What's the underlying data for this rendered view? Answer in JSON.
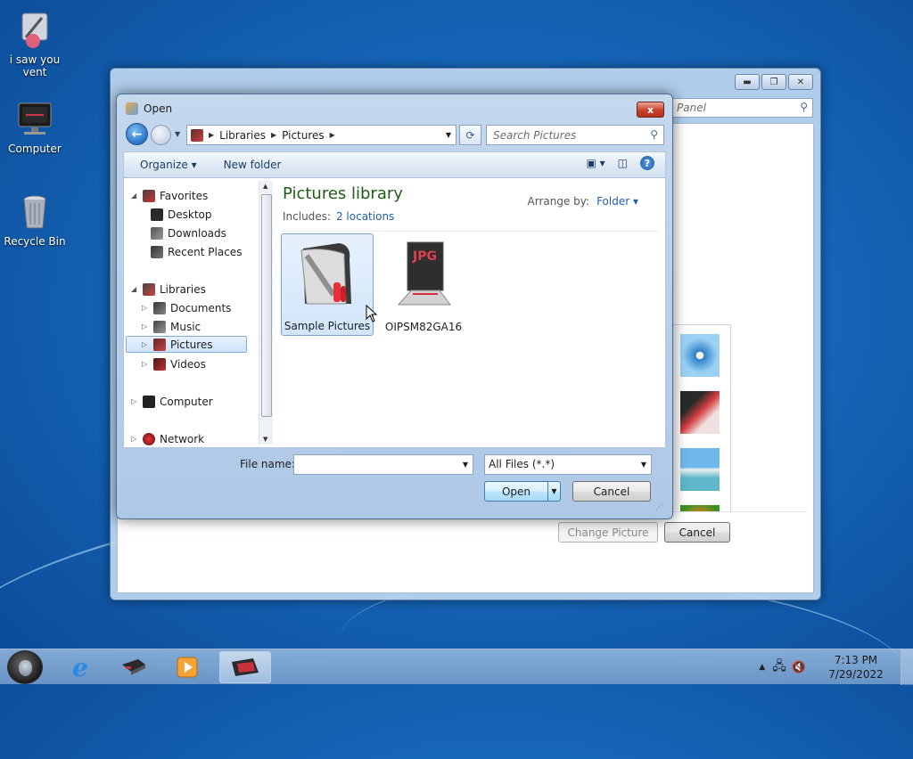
{
  "desktop": {
    "icons": [
      {
        "label": "i saw you vent"
      },
      {
        "label": "Computer"
      },
      {
        "label": "Recycle Bin"
      }
    ]
  },
  "back_window": {
    "search_placeholder": "Panel",
    "change_picture_label": "Change Picture",
    "cancel_label": "Cancel",
    "caption_buttons": [
      "minimize",
      "maximize",
      "close"
    ]
  },
  "dialog": {
    "title": "Open",
    "close_label": "x",
    "breadcrumb": [
      "Libraries",
      "Pictures"
    ],
    "search_placeholder": "Search Pictures",
    "toolbar": {
      "organize_label": "Organize",
      "new_folder_label": "New folder"
    },
    "nav": {
      "favorites_label": "Favorites",
      "favorites": [
        "Desktop",
        "Downloads",
        "Recent Places"
      ],
      "libraries_label": "Libraries",
      "libraries": [
        "Documents",
        "Music",
        "Pictures",
        "Videos"
      ],
      "selected": "Pictures",
      "computer_label": "Computer",
      "network_label": "Network"
    },
    "content": {
      "title": "Pictures library",
      "includes_label": "Includes:",
      "includes_link": "2 locations",
      "arrange_label": "Arrange by:",
      "arrange_value": "Folder",
      "items": [
        {
          "label": "Sample Pictures",
          "selected": true
        },
        {
          "label": "OIPSM82GA16",
          "selected": false,
          "badge": "JPG"
        }
      ]
    },
    "file_name_label": "File name:",
    "file_name_value": "",
    "filter_value": "All Files (*.*)",
    "open_label": "Open",
    "cancel_label": "Cancel"
  },
  "taskbar": {
    "time": "7:13 PM",
    "date": "7/29/2022"
  },
  "colors": {
    "library_title": "#1e5e14",
    "link": "#1e5fa8",
    "selection": "#cfe3f9"
  }
}
